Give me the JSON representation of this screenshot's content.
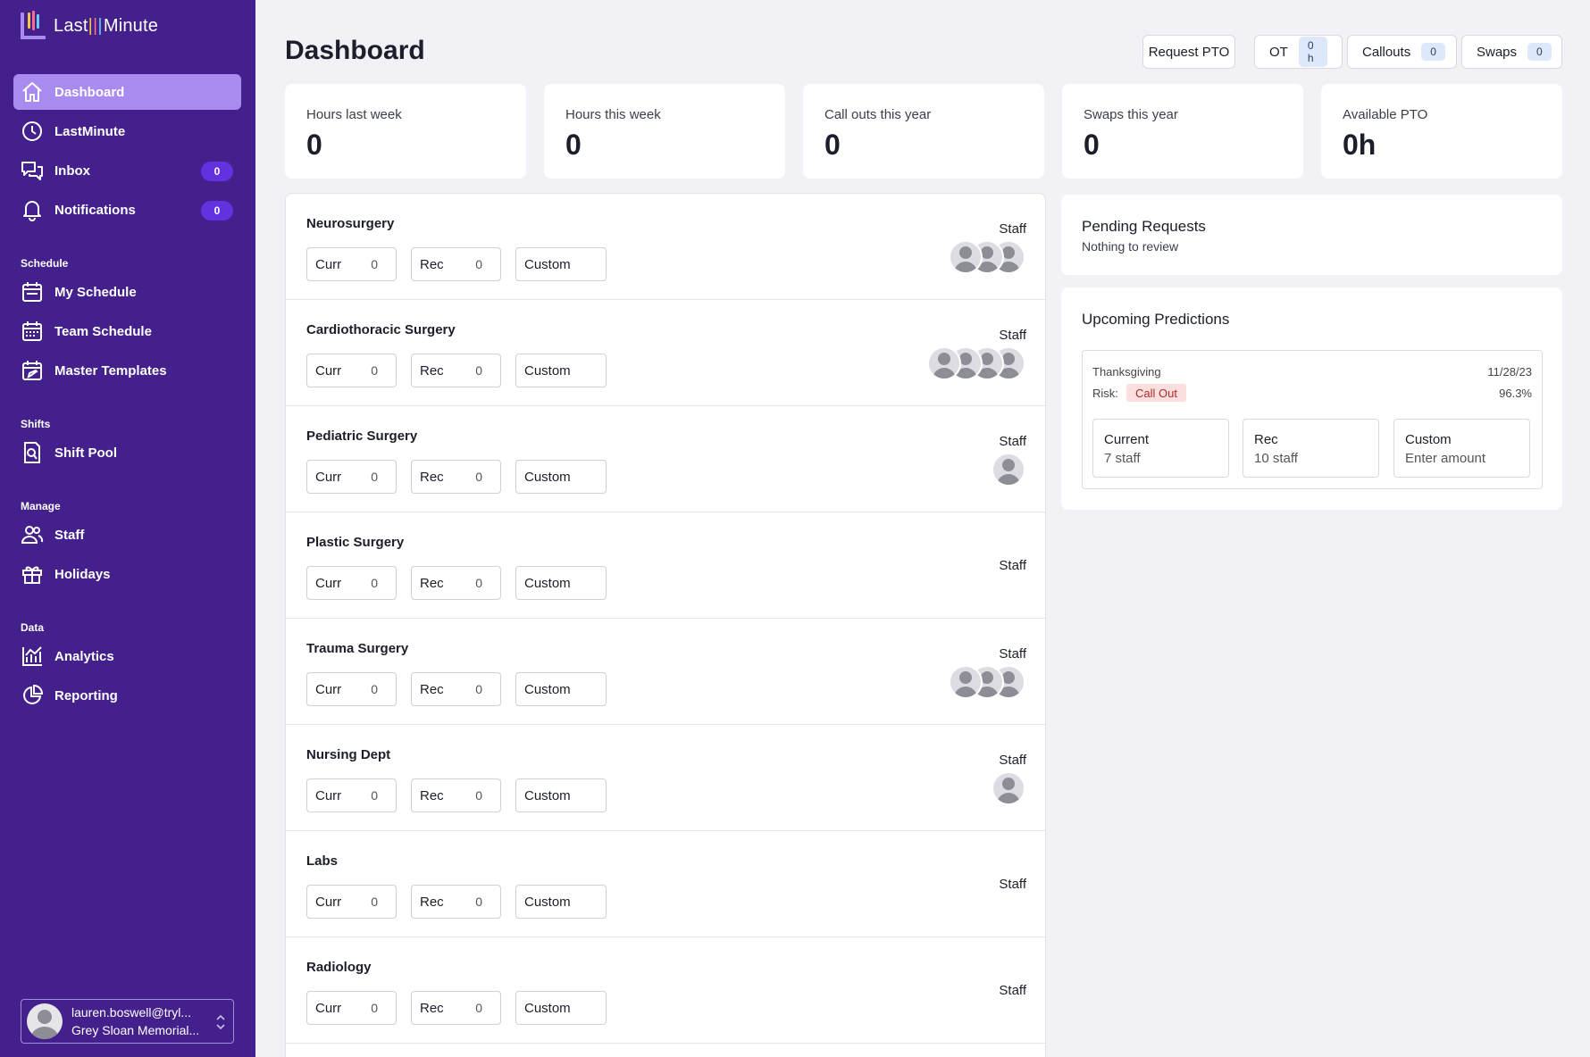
{
  "app": {
    "name_part1": "Last",
    "name_part2": "Minute"
  },
  "colors": {
    "sidebar": "#43208c",
    "active_nav": "#a98bf0",
    "badge": "#6232e0",
    "risk_bg": "#fbdede",
    "risk_text": "#b02a2a"
  },
  "sidebar": {
    "main": [
      {
        "label": "Dashboard",
        "icon": "home-icon"
      },
      {
        "label": "LastMinute",
        "icon": "clock-icon"
      },
      {
        "label": "Inbox",
        "icon": "chat-icon",
        "badge": "0"
      },
      {
        "label": "Notifications",
        "icon": "bell-icon",
        "badge": "0"
      }
    ],
    "sections": [
      {
        "label": "Schedule",
        "items": [
          {
            "label": "My Schedule",
            "icon": "calendar-icon"
          },
          {
            "label": "Team Schedule",
            "icon": "calendar-grid-icon"
          },
          {
            "label": "Master Templates",
            "icon": "calendar-edit-icon"
          }
        ]
      },
      {
        "label": "Shifts",
        "items": [
          {
            "label": "Shift Pool",
            "icon": "search-document-icon"
          }
        ]
      },
      {
        "label": "Manage",
        "items": [
          {
            "label": "Staff",
            "icon": "users-icon"
          },
          {
            "label": "Holidays",
            "icon": "gift-icon"
          }
        ]
      },
      {
        "label": "Data",
        "items": [
          {
            "label": "Analytics",
            "icon": "chart-icon"
          },
          {
            "label": "Reporting",
            "icon": "pie-chart-icon"
          }
        ]
      }
    ],
    "user": {
      "email": "lauren.boswell@tryl...",
      "org": "Grey Sloan Memorial..."
    }
  },
  "header": {
    "title": "Dashboard",
    "request_pto": "Request PTO",
    "ot_label": "OT",
    "ot_value": "0 h",
    "callouts_label": "Callouts",
    "callouts_value": "0",
    "swaps_label": "Swaps",
    "swaps_value": "0"
  },
  "stats": [
    {
      "label": "Hours last week",
      "value": "0"
    },
    {
      "label": "Hours this week",
      "value": "0"
    },
    {
      "label": "Call outs this year",
      "value": "0"
    },
    {
      "label": "Swaps this year",
      "value": "0"
    },
    {
      "label": "Available PTO",
      "value": "0h"
    }
  ],
  "field_labels": {
    "curr": "Curr",
    "rec": "Rec",
    "custom": "Custom",
    "staff": "Staff"
  },
  "departments": [
    {
      "name": "Neurosurgery",
      "curr": "0",
      "rec": "0",
      "avatars": 3
    },
    {
      "name": "Cardiothoracic Surgery",
      "curr": "0",
      "rec": "0",
      "avatars": 4
    },
    {
      "name": "Pediatric Surgery",
      "curr": "0",
      "rec": "0",
      "avatars": 1
    },
    {
      "name": "Plastic Surgery",
      "curr": "0",
      "rec": "0",
      "avatars": 0
    },
    {
      "name": "Trauma Surgery",
      "curr": "0",
      "rec": "0",
      "avatars": 3
    },
    {
      "name": "Nursing Dept",
      "curr": "0",
      "rec": "0",
      "avatars": 1
    },
    {
      "name": "Labs",
      "curr": "0",
      "rec": "0",
      "avatars": 0
    },
    {
      "name": "Radiology",
      "curr": "0",
      "rec": "0",
      "avatars": 0
    }
  ],
  "pending": {
    "title": "Pending Requests",
    "subtitle": "Nothing to review"
  },
  "predictions": {
    "title": "Upcoming Predictions",
    "holiday": "Thanksgiving",
    "date": "11/28/23",
    "risk_label": "Risk:",
    "risk": "Call Out",
    "percent": "96.3%",
    "options": [
      {
        "title": "Current",
        "sub": "7 staff"
      },
      {
        "title": "Rec",
        "sub": "10 staff"
      },
      {
        "title": "Custom",
        "sub": "Enter amount"
      }
    ]
  }
}
